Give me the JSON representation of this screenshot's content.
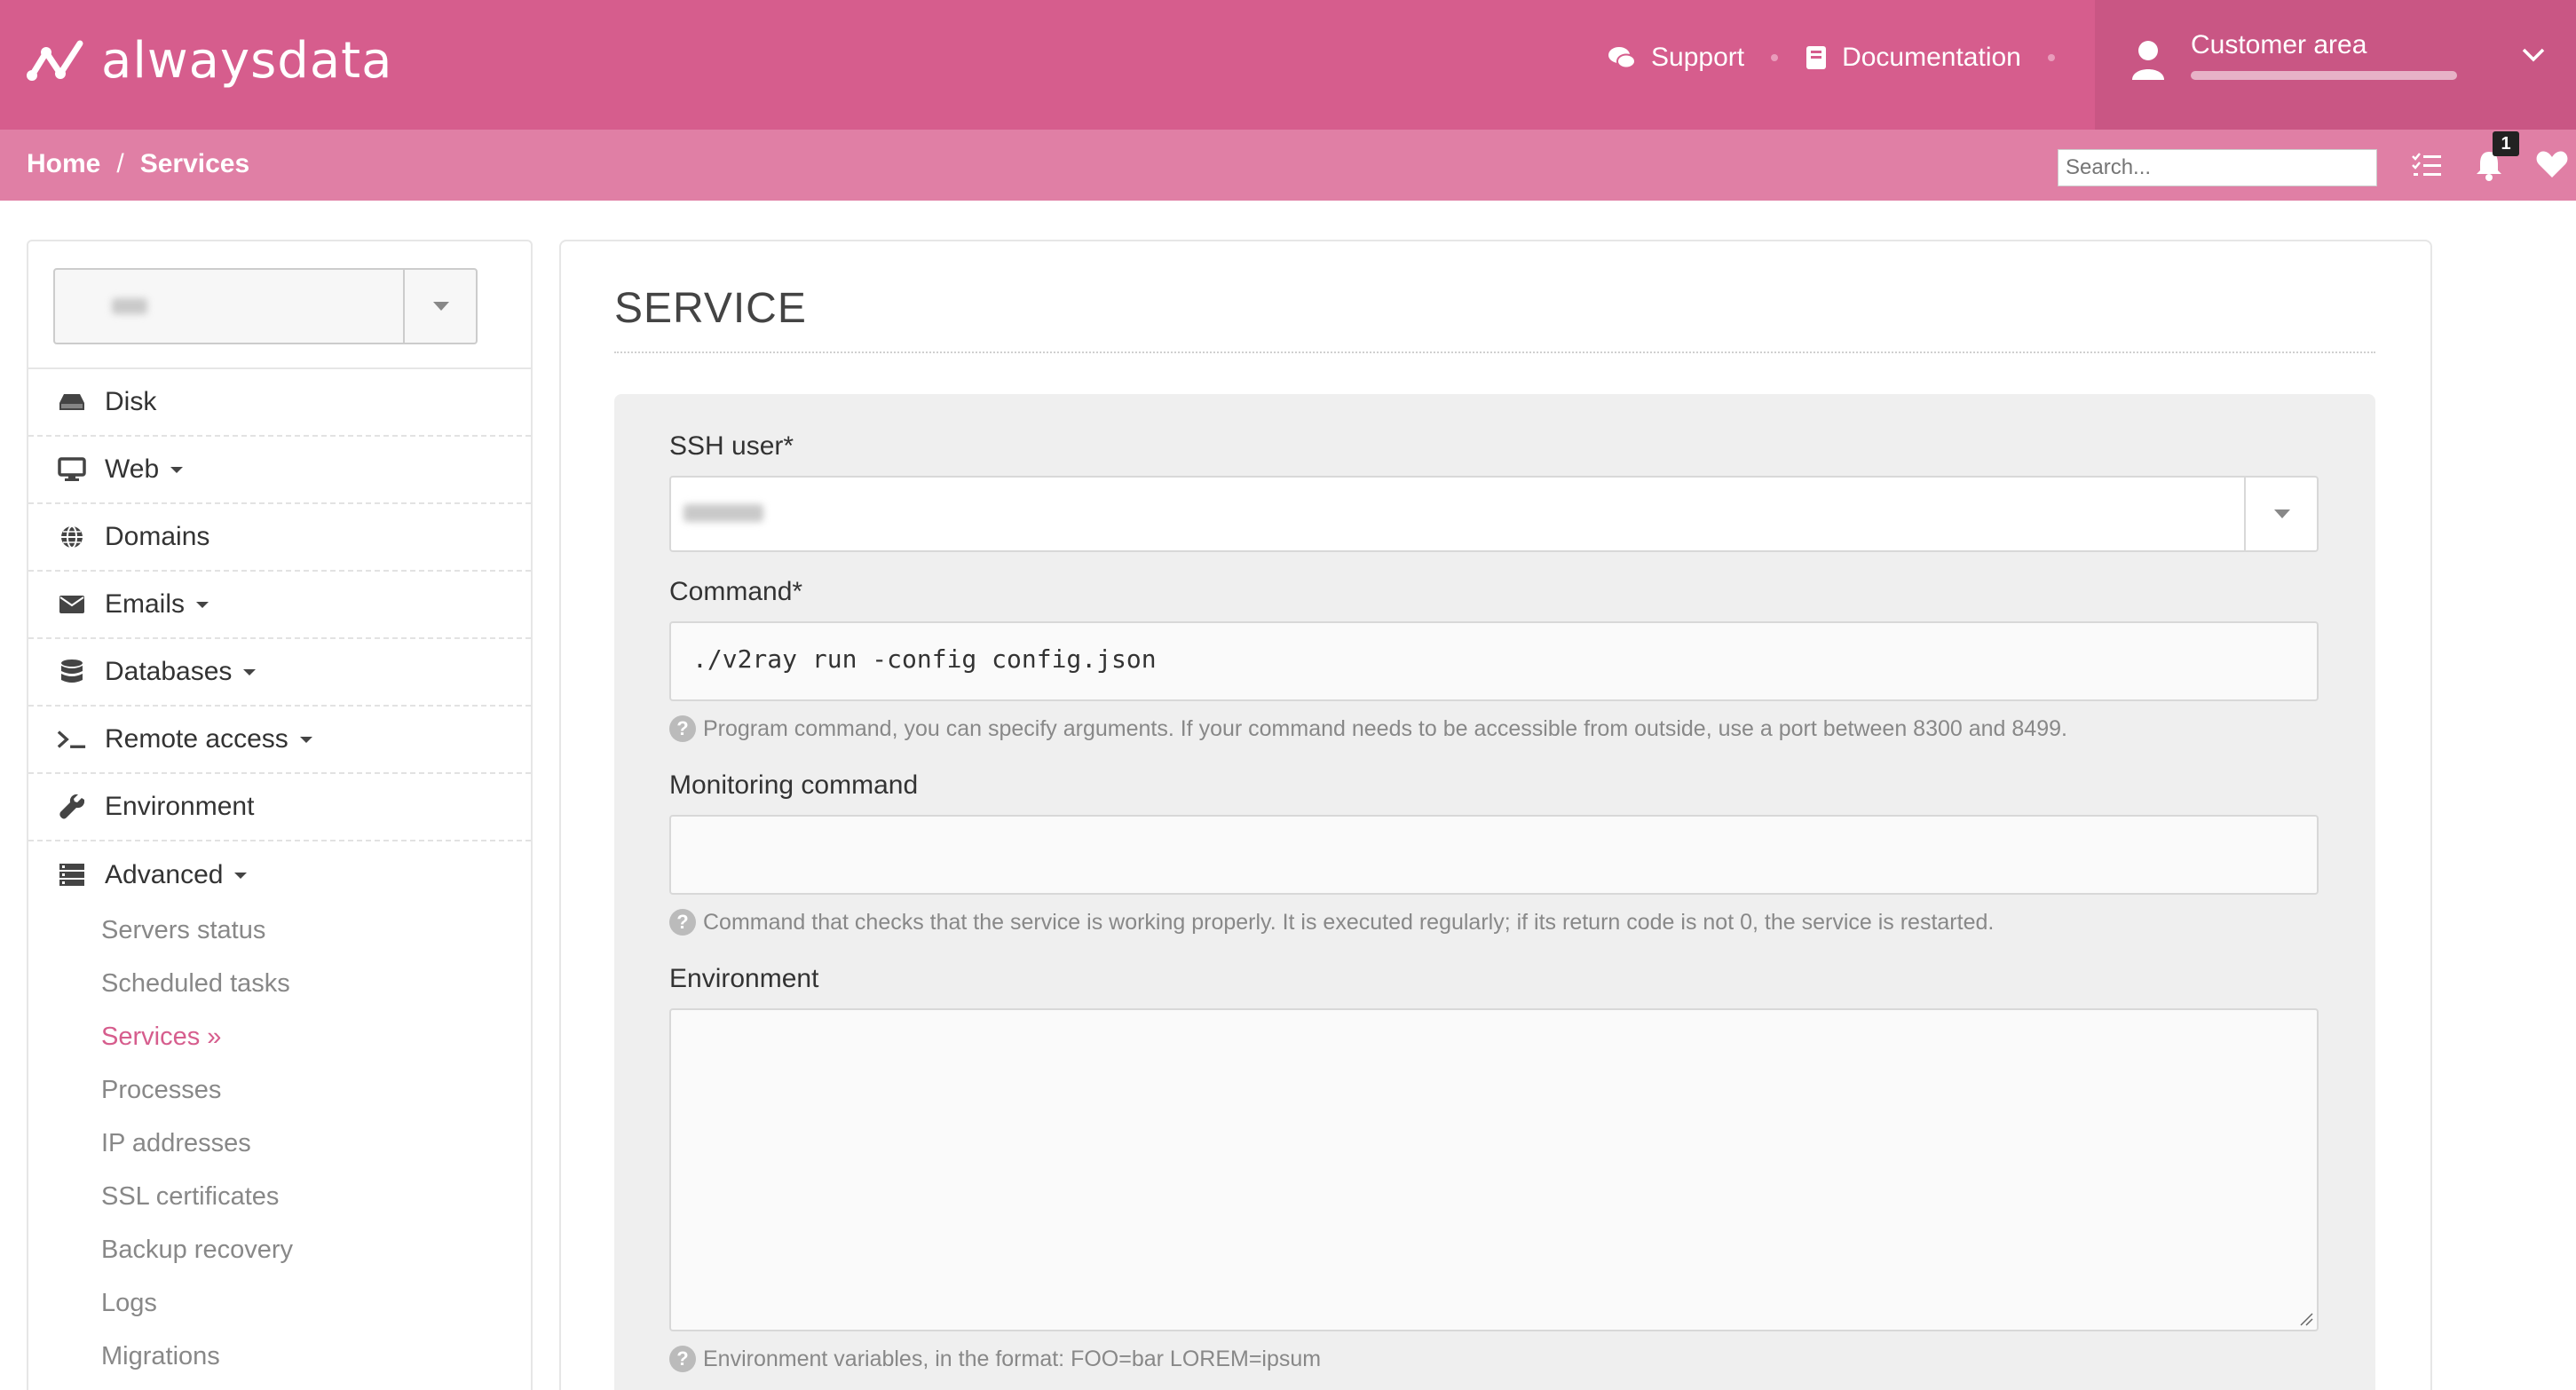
{
  "header": {
    "brand": "alwaysdata",
    "support_label": "Support",
    "docs_label": "Documentation",
    "customer_label": "Customer area"
  },
  "breadcrumb": {
    "home": "Home",
    "separator": "/",
    "current": "Services"
  },
  "search": {
    "placeholder": "Search..."
  },
  "notifications": {
    "count": "1"
  },
  "sidebar": {
    "items": [
      {
        "label": "Disk",
        "icon": "disk-icon"
      },
      {
        "label": "Web",
        "icon": "monitor-icon"
      },
      {
        "label": "Domains",
        "icon": "globe-icon"
      },
      {
        "label": "Emails",
        "icon": "envelope-icon"
      },
      {
        "label": "Databases",
        "icon": "database-icon"
      },
      {
        "label": "Remote access",
        "icon": "terminal-icon"
      },
      {
        "label": "Environment",
        "icon": "wrench-icon"
      },
      {
        "label": "Advanced",
        "icon": "server-icon"
      }
    ],
    "advanced_sub": [
      "Servers status",
      "Scheduled tasks",
      "Services »",
      "Processes",
      "IP addresses",
      "SSL certificates",
      "Backup recovery",
      "Logs",
      "Migrations"
    ]
  },
  "main": {
    "title": "SERVICE",
    "ssh_user_label": "SSH user*",
    "command_label": "Command*",
    "command_value": "./v2ray run -config config.json",
    "command_help": "Program command, you can specify arguments. If your command needs to be accessible from outside, use a port between 8300 and 8499.",
    "monitoring_label": "Monitoring command",
    "monitoring_value": "",
    "monitoring_help": "Command that checks that the service is working properly. It is executed regularly; if its return code is not 0, the service is restarted.",
    "environment_label": "Environment",
    "environment_value": "",
    "environment_help": "Environment variables, in the format: FOO=bar LOREM=ipsum",
    "help_icon_glyph": "?"
  },
  "colors": {
    "brand_pink": "#d65d8d",
    "breadcrumb_pink": "#e07fa5",
    "active_link": "#d65d8d"
  }
}
